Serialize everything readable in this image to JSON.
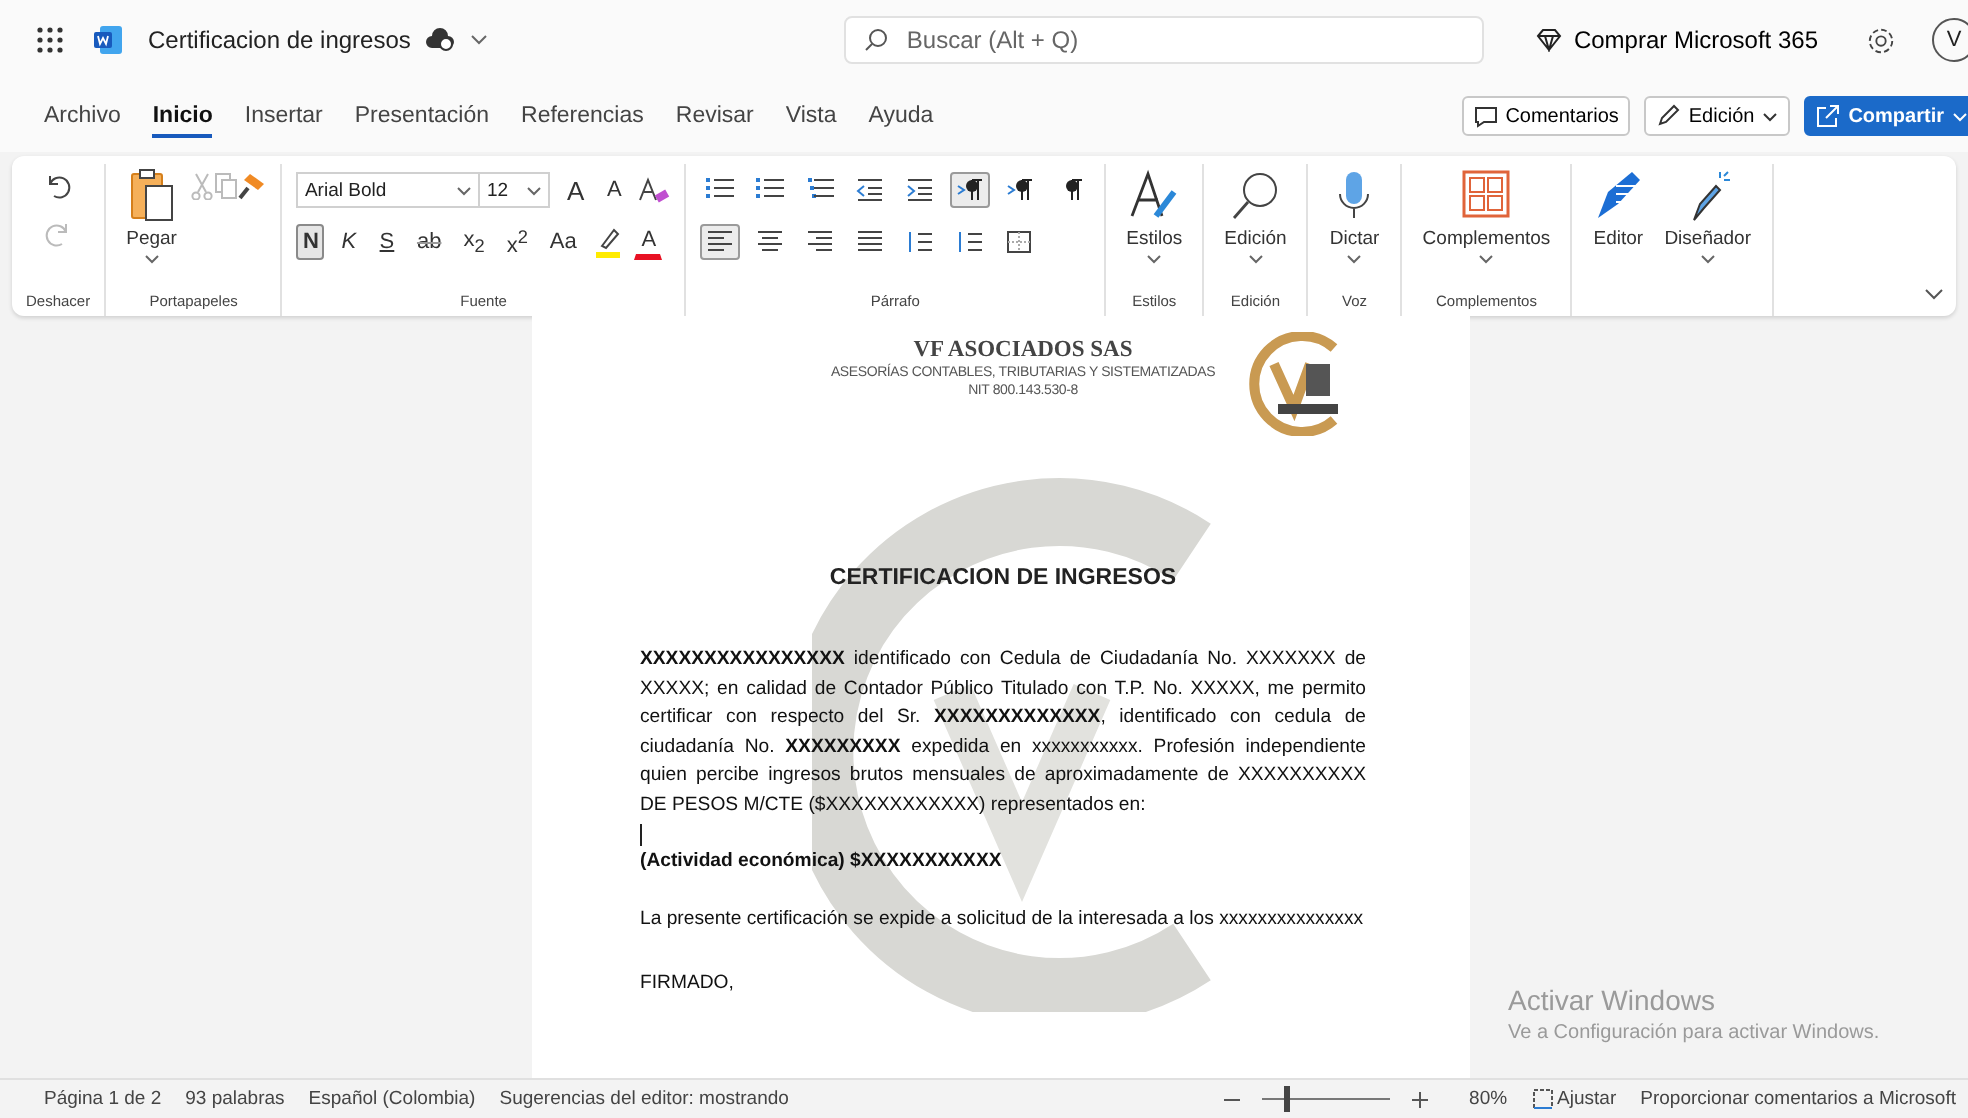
{
  "topbar": {
    "doc_title": "Certificacion de ingresos",
    "search": {
      "placeholder": "Buscar (Alt + Q)"
    },
    "buy": "Comprar Microsoft 365",
    "avatar": "V"
  },
  "tabs": [
    {
      "label": "Archivo",
      "selected": false
    },
    {
      "label": "Inicio",
      "selected": true
    },
    {
      "label": "Insertar",
      "selected": false
    },
    {
      "label": "Presentación",
      "selected": false
    },
    {
      "label": "Referencias",
      "selected": false
    },
    {
      "label": "Revisar",
      "selected": false
    },
    {
      "label": "Vista",
      "selected": false
    },
    {
      "label": "Ayuda",
      "selected": false
    }
  ],
  "actions": {
    "comments": "Comentarios",
    "editing": "Edición",
    "share": "Compartir"
  },
  "ribbon": {
    "undo_group": "Deshacer",
    "clipboard": {
      "paste": "Pegar",
      "group": "Portapapeles"
    },
    "font": {
      "name": "Arial Bold",
      "size": "12",
      "size_buttons": [
        "A",
        "A"
      ],
      "group": "Fuente",
      "color_label": "A",
      "format_buttons": [
        {
          "label": "N",
          "kind": "bold",
          "selected": true
        },
        {
          "label": "K",
          "kind": "italic",
          "selected": false
        },
        {
          "label": "S",
          "kind": "underline",
          "selected": false
        },
        {
          "label": "ab",
          "kind": "strike",
          "selected": false
        },
        {
          "label": "x$_{2}$",
          "kind": "plain",
          "selected": false
        },
        {
          "label": "x$^{2}$",
          "kind": "plain",
          "selected": false
        },
        {
          "label": "Aa",
          "kind": "plain",
          "selected": false
        }
      ]
    },
    "paragraph": {
      "group": "Párrafo",
      "row1": [
        {
          "kind": "bullets",
          "selected": false
        },
        {
          "kind": "numbers",
          "selected": false
        },
        {
          "kind": "multilevel",
          "selected": false
        },
        {
          "kind": "outdent",
          "selected": false
        },
        {
          "kind": "indent",
          "selected": false
        },
        {
          "kind": "ltr",
          "selected": true
        },
        {
          "kind": "rtl",
          "selected": false
        },
        {
          "kind": "pilcrow",
          "selected": false
        }
      ],
      "row2": [
        {
          "kind": "align-left",
          "selected": true
        },
        {
          "kind": "align-center",
          "selected": false
        },
        {
          "kind": "align-right",
          "selected": false
        },
        {
          "kind": "justify",
          "selected": false
        },
        {
          "kind": "line-spacing",
          "selected": false
        },
        {
          "kind": "spacing",
          "selected": false
        },
        {
          "kind": "borders",
          "selected": false
        }
      ]
    },
    "big_groups": [
      {
        "buttons": [
          {
            "label": "Estilos",
            "kind": "styles"
          }
        ],
        "group": "Estilos"
      },
      {
        "buttons": [
          {
            "label": "Edición",
            "kind": "find"
          }
        ],
        "group": "Edición"
      },
      {
        "buttons": [
          {
            "label": "Dictar",
            "kind": "mic"
          }
        ],
        "group": "Voz"
      },
      {
        "buttons": [
          {
            "label": "Complementos",
            "kind": "addins"
          }
        ],
        "group": "Complementos"
      },
      {
        "buttons": [
          {
            "label": "Editor",
            "kind": "editor"
          },
          {
            "label": "Diseñador",
            "kind": "designer"
          }
        ]
      }
    ]
  },
  "document": {
    "company": "VF ASOCIADOS SAS",
    "subtitle": "ASESORÍAS CONTABLES, TRIBUTARIAS Y SISTEMATIZADAS",
    "nit": "NIT 800.143.530-8",
    "title": "CERTIFICACION DE INGRESOS",
    "body": "**XXXXXXXXXXXXXXXX** identificado con Cedula de Ciudadanía No. XXXXXXX de XXXXX; en calidad de Contador Público Titulado con T.P. No. XXXXX, me permito certificar con respecto del Sr. **XXXXXXXXXXXXX**, identificado con cedula de ciudadanía No. **XXXXXXXXX** expedida en xxxxxxxxxxx. Profesión independiente quien percibe ingresos brutos mensuales de aproximadamente de XXXXXXXXXX DE PESOS M/CTE ($XXXXXXXXXXXX) representados en:",
    "activity": "(Actividad económica) $XXXXXXXXXXX",
    "closing": "La presente certificación se expide a solicitud de la interesada a los xxxxxxxxxxxxxxx",
    "signed": "FIRMADO,"
  },
  "activation": {
    "title": "Activar Windows",
    "hint": "Ve a Configuración para activar Windows."
  },
  "status_bar": {
    "page": "Página 1 de 2",
    "words": "93 palabras",
    "language": "Español (Colombia)",
    "suggestions": "Sugerencias del editor: mostrando",
    "zoom": {
      "level": 0.18
    },
    "zoom_value": "80%",
    "fit": "Ajustar",
    "feedback": "Proporcionar comentarios a Microsoft"
  }
}
